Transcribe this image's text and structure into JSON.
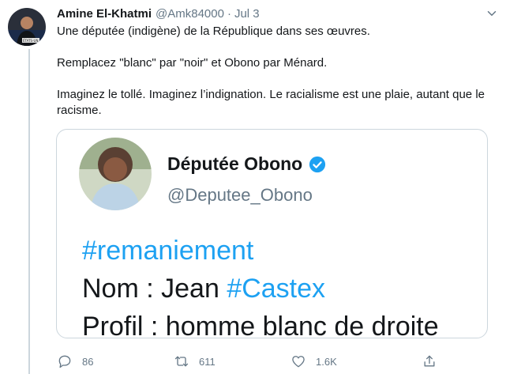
{
  "tweet": {
    "author_name": "Amine El-Khatmi",
    "handle": "@Amk84000",
    "separator": "·",
    "date": "Jul 3",
    "paragraphs": [
      "Une députée (indigène) de la République dans ses œuvres.",
      "Remplacez \"blanc\" par \"noir\" et Obono par Ménard.",
      "Imaginez le tollé. Imaginez l’indignation. Le racialisme est une plaie, autant que le racisme."
    ],
    "avatar_caption": "ÉTATS-UN"
  },
  "media": {
    "name": "Députée Obono",
    "handle": "@Deputee_Obono",
    "line1_hashtag": "#remaniement",
    "line2_prefix": "Nom : Jean ",
    "line2_hashtag": "#Castex",
    "line3": "Profil : homme blanc de droite"
  },
  "actions": {
    "replies": "86",
    "retweets": "611",
    "likes": "1.6K"
  },
  "colors": {
    "accent": "#1da1f2",
    "muted": "#657786",
    "text": "#14171a",
    "border": "#ccd6dd"
  },
  "icons": [
    "chevron-down-icon",
    "verified-badge-icon",
    "reply-icon",
    "retweet-icon",
    "like-icon",
    "share-icon"
  ]
}
